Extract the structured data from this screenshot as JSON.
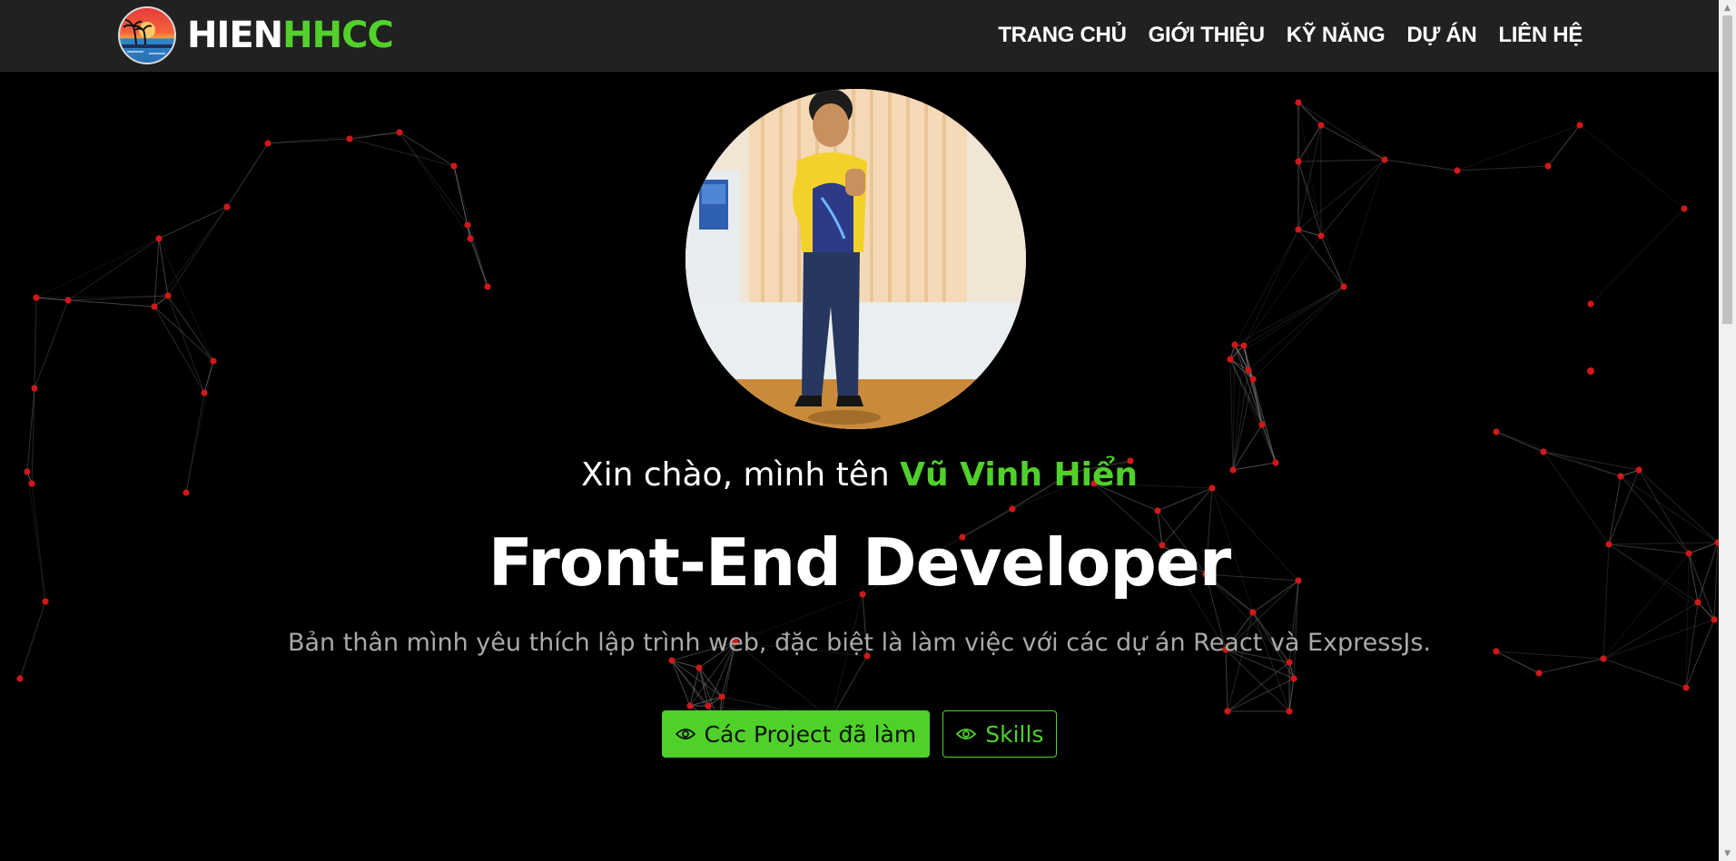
{
  "brand": {
    "part1": "HIEN",
    "part2": "HHCC",
    "logo_icon": "palm-sunset-logo"
  },
  "nav": [
    {
      "label": "TRANG CHỦ"
    },
    {
      "label": "GIỚI THIỆU"
    },
    {
      "label": "KỸ NĂNG"
    },
    {
      "label": "DỰ ÁN"
    },
    {
      "label": "LIÊN HỆ"
    }
  ],
  "hero": {
    "greeting": "Xin chào, mình tên",
    "name": "Vũ Vinh Hiển",
    "title": "Front-End Developer",
    "description": "Bản thân mình yêu thích lập trình web, đặc biệt là làm việc với các dự án React và ExpressJs.",
    "primary_button": "Các Project đã làm",
    "secondary_button": "Skills",
    "button_icon": "eye-icon"
  },
  "colors": {
    "accent": "#4fd12a",
    "navbar": "#212121",
    "background": "#000000",
    "network_node": "#d01818"
  }
}
